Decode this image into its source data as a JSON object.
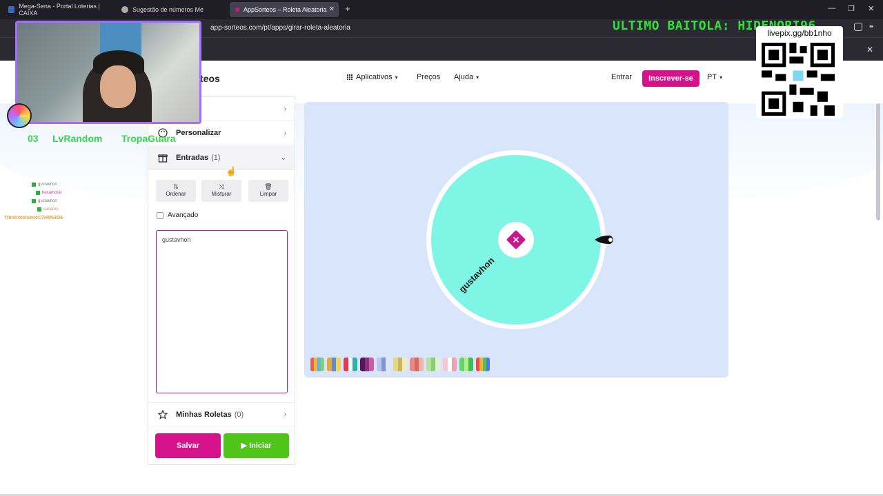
{
  "browser": {
    "tabs": [
      {
        "title": "Mega-Sena - Portal Loterias | CAIXA"
      },
      {
        "title": "Sugestão de números Me"
      },
      {
        "title": "AppSorteos – Roleta Aleatoria"
      }
    ],
    "url": "app-sorteos.com/pt/apps/girar-roleta-aleatoria"
  },
  "header": {
    "brand_partial": "teos",
    "nav": {
      "apps": "Aplicativos",
      "prices": "Preços",
      "help": "Ajuda",
      "login": "Entrar",
      "register": "Inscrever-se",
      "lang": "PT"
    }
  },
  "panel": {
    "customize_label": "Personalizar",
    "entries_label": "Entradas",
    "entries_count": "(1)",
    "tools": {
      "sort": "Ordenar",
      "shuffle": "Misturar",
      "clear": "Limpar"
    },
    "advanced_label": "Avançado",
    "entries_text": "gustavhon",
    "my_wheels_label": "Minhas Roletas",
    "my_wheels_count": "(0)",
    "save_label": "Salvar",
    "start_label": "Iniciar"
  },
  "wheel": {
    "segments": [
      {
        "label": "gustavhon",
        "color": "#7ff5e6"
      }
    ],
    "center_color": "#c8178f"
  },
  "palettes": [
    [
      "#e25f5f",
      "#f0b63b",
      "#59b8e2",
      "#8bd16c"
    ],
    [
      "#e8a73a",
      "#5c8fd6",
      "#f2d35b"
    ],
    [
      "#e03c4f",
      "#f7f7f7",
      "#2ab3a9"
    ],
    [
      "#4d1b5b",
      "#8e2f7e",
      "#c85ea3"
    ],
    [
      "#b9c6ef",
      "#7f93d9",
      "#dfe5f7"
    ],
    [
      "#e7d77f",
      "#c7b55f",
      "#f3ebbd"
    ],
    [
      "#e58a84",
      "#d66a63",
      "#f0b3a8"
    ],
    [
      "#b8e0a3",
      "#8ccc72",
      "#dff1d3"
    ],
    [
      "#f7c6d0",
      "#ffffff",
      "#f29fb0"
    ],
    [
      "#64d368",
      "#b3ee93",
      "#3fbf53"
    ],
    [
      "#ea4b48",
      "#f3b13e",
      "#59bf4d",
      "#4b7be6"
    ]
  ],
  "overlay": {
    "last_winner": "ULTIMO BAITOLA: HIDENORI96",
    "donation_link": "livepix.gg/bb1nho",
    "stream_names": [
      "03",
      "LvRandom",
      "TropaGuara"
    ],
    "chat_users": [
      "gustavhon",
      "hexamoral",
      "gustavhon",
      "canareo"
    ],
    "chat_last": "TrinitrotolueneC7H5N3O6"
  }
}
